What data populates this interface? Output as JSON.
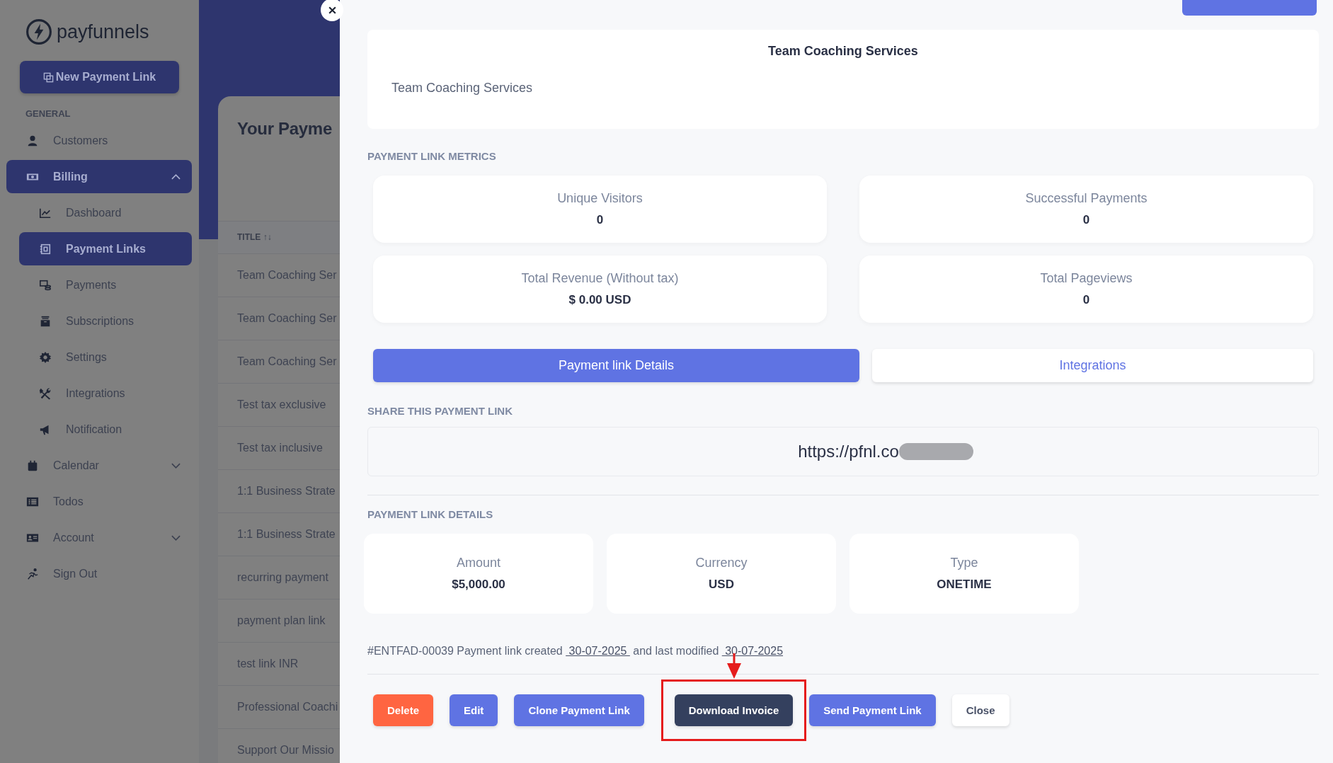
{
  "sidebar": {
    "logo": "payfunnels",
    "new_button": "New Payment Link",
    "section": "GENERAL",
    "items": [
      {
        "label": "Customers",
        "selected": false
      },
      {
        "label": "Billing",
        "selected": true,
        "expanded": true,
        "children": [
          {
            "label": "Dashboard",
            "selected": false
          },
          {
            "label": "Payment Links",
            "selected": true
          },
          {
            "label": "Payments",
            "selected": false
          },
          {
            "label": "Subscriptions",
            "selected": false
          },
          {
            "label": "Settings",
            "selected": false
          },
          {
            "label": "Integrations",
            "selected": false
          },
          {
            "label": "Notification",
            "selected": false
          }
        ]
      },
      {
        "label": "Calendar",
        "selected": false,
        "expanded": false
      },
      {
        "label": "Todos",
        "selected": false
      },
      {
        "label": "Account",
        "selected": false,
        "expanded": false
      },
      {
        "label": "Sign Out",
        "selected": false
      }
    ]
  },
  "background_page": {
    "heading": "Your Payme",
    "column": "TITLE ↑↓",
    "rows": [
      "Team Coaching Ser",
      "Team Coaching Ser",
      "Team Coaching Ser",
      "Test tax exclusive",
      "Test tax inclusive",
      "1:1 Business Strate",
      "1:1 Business Strate",
      "recurring payment",
      "payment plan link",
      "test link INR",
      "Professional Coachi",
      "Support Our Missio"
    ]
  },
  "panel": {
    "header": {
      "title": "Team Coaching Services",
      "description": "Team Coaching Services"
    },
    "metrics_label": "PAYMENT LINK METRICS",
    "metrics": [
      {
        "label": "Unique Visitors",
        "value": "0"
      },
      {
        "label": "Successful Payments",
        "value": "0"
      },
      {
        "label": "Total Revenue (Without tax)",
        "value": "$ 0.00 USD"
      },
      {
        "label": "Total Pageviews",
        "value": "0"
      }
    ],
    "tabs": [
      {
        "label": "Payment link Details",
        "selected": true
      },
      {
        "label": "Integrations",
        "selected": false
      }
    ],
    "share_label": "SHARE THIS PAYMENT LINK",
    "link": "https://pfnl.co",
    "details_label": "PAYMENT LINK DETAILS",
    "details": [
      {
        "label": "Amount",
        "value": "$5,000.00"
      },
      {
        "label": "Currency",
        "value": "USD"
      },
      {
        "label": "Type",
        "value": "ONETIME"
      }
    ],
    "footer": {
      "intro": "#ENTFAD-00039 Payment link created",
      "created": " 30-07-2025 ",
      "middle": "and last modified",
      "modified": " 30-07-2025"
    },
    "buttons": [
      {
        "label": "Delete",
        "kind": "danger"
      },
      {
        "label": "Edit",
        "kind": "primary"
      },
      {
        "label": "Clone Payment Link",
        "kind": "primary"
      },
      {
        "label": "Download Invoice",
        "kind": "dark",
        "highlighted": true
      },
      {
        "label": "Send Payment Link",
        "kind": "primary"
      },
      {
        "label": "Close",
        "kind": "light"
      }
    ]
  }
}
